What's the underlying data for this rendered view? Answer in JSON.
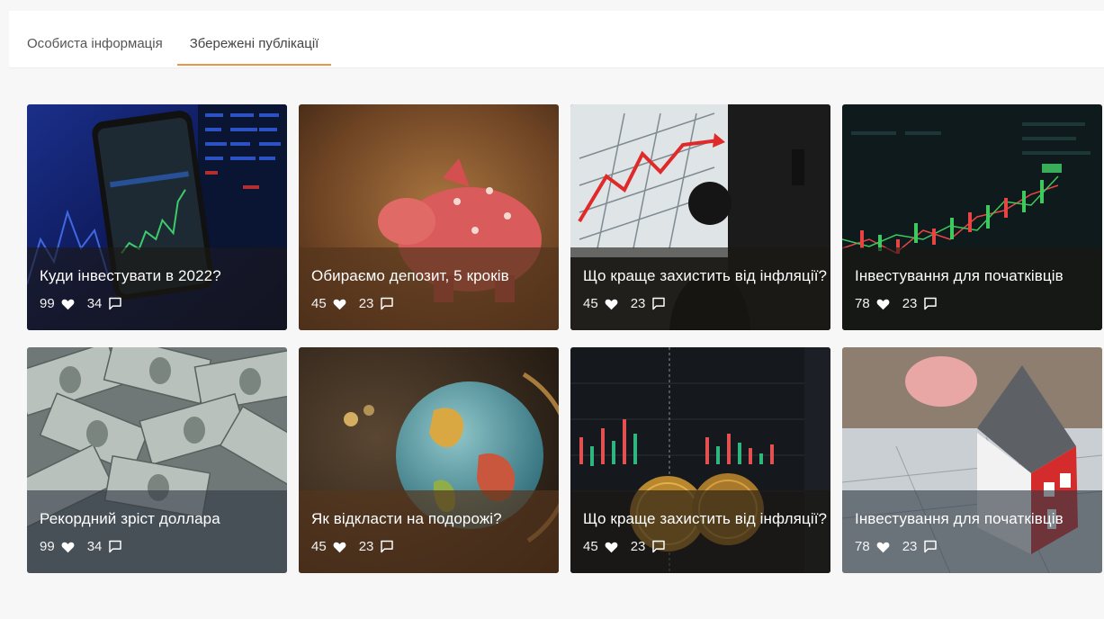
{
  "tabs": [
    {
      "label": "Особиста інформація",
      "active": false
    },
    {
      "label": "Збережені публікації",
      "active": true
    }
  ],
  "accent_color": "#e8974a",
  "posts": [
    {
      "title": "Куди інвестувати в 2022?",
      "likes": "99",
      "comments": "34",
      "image": "smartphone-stock-chart"
    },
    {
      "title": "Обираємо депозит, 5 кроків",
      "likes": "45",
      "comments": "23",
      "image": "piggy-bank"
    },
    {
      "title": "Що краще захистить від інфляції?",
      "likes": "45",
      "comments": "23",
      "image": "presentation-growth-chart"
    },
    {
      "title": "Інвестування для початківців",
      "likes": "78",
      "comments": "23",
      "image": "candlestick-chart"
    },
    {
      "title": "Рекордний зріст доллара",
      "likes": "99",
      "comments": "34",
      "image": "dollar-bills"
    },
    {
      "title": "Як відкласти на подорожі?",
      "likes": "45",
      "comments": "23",
      "image": "globe"
    },
    {
      "title": "Що краще захистить від інфляції?",
      "likes": "45",
      "comments": "23",
      "image": "bitcoin-coins"
    },
    {
      "title": "Інвестування для початківців",
      "likes": "78",
      "comments": "23",
      "image": "house-model"
    }
  ]
}
